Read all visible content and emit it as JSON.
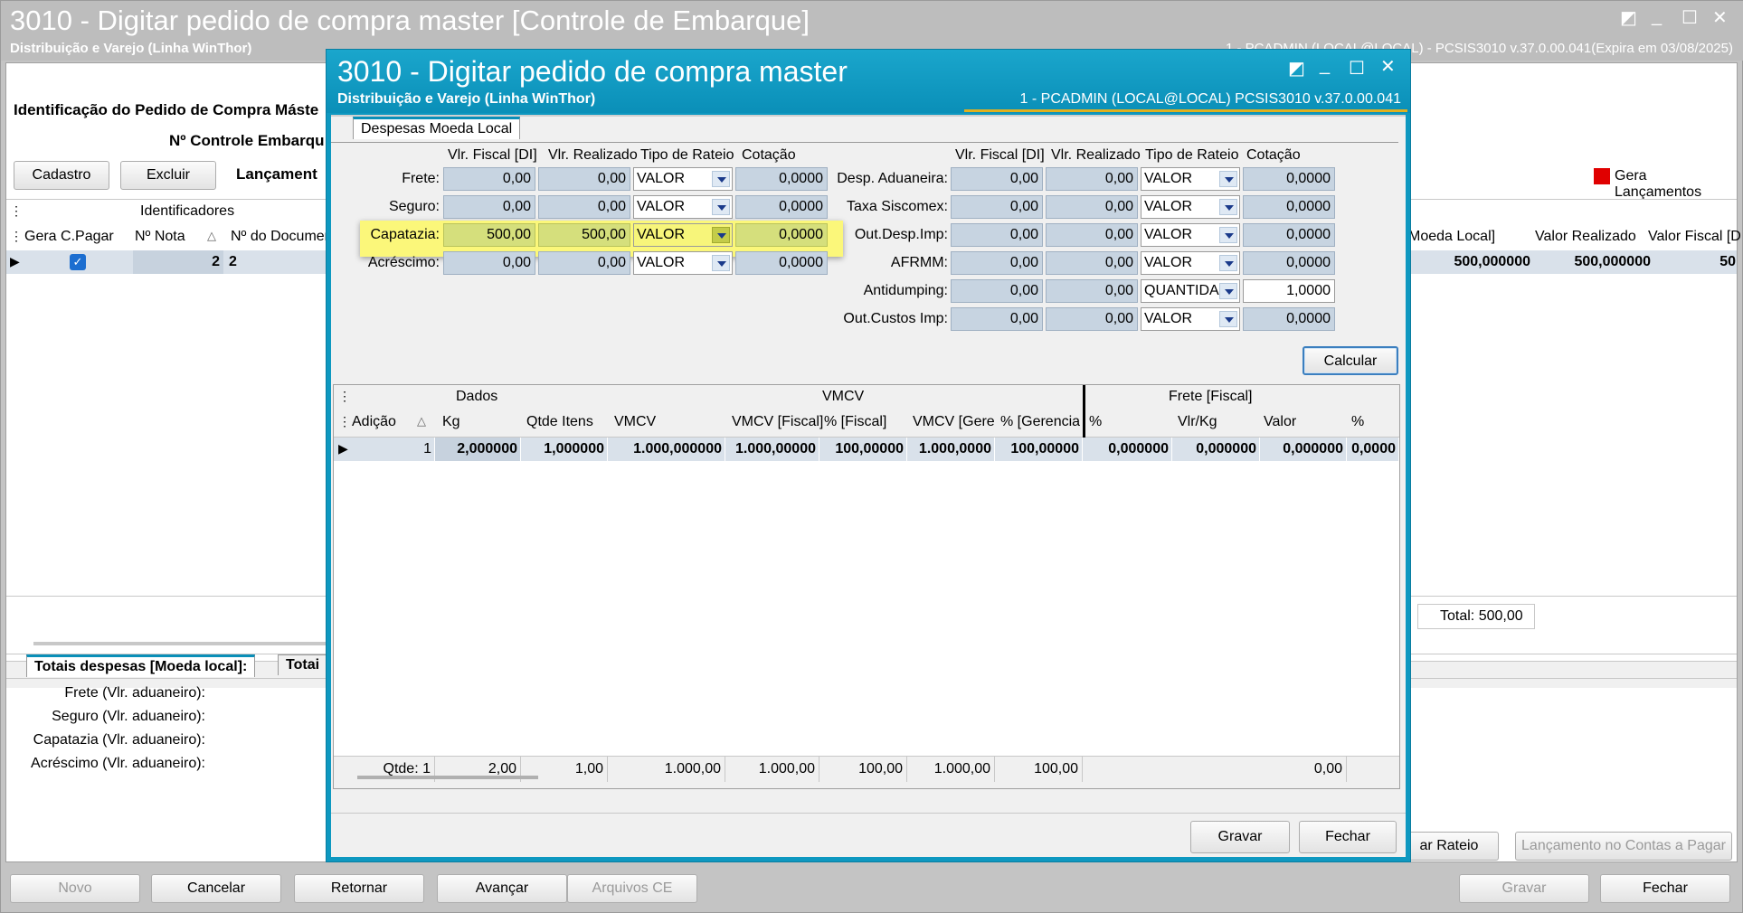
{
  "outer": {
    "title": "3010 - Digitar pedido de compra master [Controle de Embarque]",
    "subtitle": "Distribuição e Varejo (Linha WinThor)",
    "user_info": "1 - PCADMIN (LOCAL@LOCAL) - PCSIS3010  v.37.0.00.041(Expira em 03/08/2025)",
    "ident_label": "Identificação do Pedido de Compra Máste",
    "controle_label": "Nº Controle Embarqu",
    "btn_cadastro": "Cadastro",
    "btn_excluir": "Excluir",
    "lancamentos_label": "Lançament",
    "gera_lancamentos": "Gera Lançamentos",
    "grid": {
      "group_header": "Identificadores",
      "columns": [
        "Gera C.Pagar",
        "Nº Nota",
        "Nº do Documen"
      ],
      "right_columns": [
        "Moeda Local]",
        "Valor Realizado",
        "Valor Fiscal [D"
      ],
      "row": {
        "nota": "2",
        "doc": "2",
        "moeda_local": "500,000000",
        "valor_realizado": "500,000000",
        "valor_fiscal": "50"
      },
      "total": "Total: 500,00"
    },
    "tabs": [
      "Totais despesas [Moeda local]:",
      "Totai"
    ],
    "totals_labels": [
      "Frete (Vlr. aduaneiro):",
      "Seguro (Vlr. aduaneiro):",
      "Capatazia (Vlr. aduaneiro):",
      "Acréscimo (Vlr. aduaneiro):"
    ],
    "btn_rateio": "ar Rateio",
    "btn_lancamento_cp": "Lançamento no Contas a Pagar",
    "bottom_buttons": {
      "novo": "Novo",
      "cancelar": "Cancelar",
      "retornar": "Retornar",
      "avancar": "Avançar",
      "arquivos": "Arquivos CE",
      "gravar": "Gravar",
      "fechar": "Fechar"
    }
  },
  "modal": {
    "title": "3010 - Digitar pedido de compra master",
    "subtitle": "Distribuição e Varejo (Linha WinThor)",
    "user_info": "1 - PCADMIN (LOCAL@LOCAL)   PCSIS3010  v.37.0.00.041",
    "tab": "Despesas Moeda Local",
    "col_headers": {
      "fiscal": "Vlr. Fiscal [DI]",
      "realizado": "Vlr. Realizado",
      "rateio": "Tipo de Rateio",
      "cotacao": "Cotação"
    },
    "left_rows": [
      {
        "label": "Frete:",
        "fiscal": "0,00",
        "realizado": "0,00",
        "rateio": "VALOR",
        "cotacao": "0,0000"
      },
      {
        "label": "Seguro:",
        "fiscal": "0,00",
        "realizado": "0,00",
        "rateio": "VALOR",
        "cotacao": "0,0000"
      },
      {
        "label": "Capatazia:",
        "fiscal": "500,00",
        "realizado": "500,00",
        "rateio": "VALOR",
        "cotacao": "0,0000"
      },
      {
        "label": "Acréscimo:",
        "fiscal": "0,00",
        "realizado": "0,00",
        "rateio": "VALOR",
        "cotacao": "0,0000"
      }
    ],
    "right_rows": [
      {
        "label": "Desp. Aduaneira:",
        "fiscal": "0,00",
        "realizado": "0,00",
        "rateio": "VALOR",
        "cotacao": "0,0000"
      },
      {
        "label": "Taxa Siscomex:",
        "fiscal": "0,00",
        "realizado": "0,00",
        "rateio": "VALOR",
        "cotacao": "0,0000"
      },
      {
        "label": "Out.Desp.Imp:",
        "fiscal": "0,00",
        "realizado": "0,00",
        "rateio": "VALOR",
        "cotacao": "0,0000"
      },
      {
        "label": "AFRMM:",
        "fiscal": "0,00",
        "realizado": "0,00",
        "rateio": "VALOR",
        "cotacao": "0,0000"
      },
      {
        "label": "Antidumping:",
        "fiscal": "0,00",
        "realizado": "0,00",
        "rateio": "QUANTIDA",
        "cotacao": "1,0000"
      },
      {
        "label": "Out.Custos Imp:",
        "fiscal": "0,00",
        "realizado": "0,00",
        "rateio": "VALOR",
        "cotacao": "0,0000"
      }
    ],
    "btn_calcular": "Calcular",
    "grid": {
      "groups": {
        "dados": "Dados",
        "vmcv": "VMCV",
        "frete": "Frete [Fiscal]"
      },
      "columns": [
        "Adição",
        "Kg",
        "Qtde Itens",
        "VMCV",
        "VMCV [Fiscal]",
        "% [Fiscal]",
        "VMCV [Gerer",
        "% [Gerencia",
        "%",
        "Vlr/Kg",
        "Valor",
        "%"
      ],
      "row": [
        "1",
        "2,000000",
        "1,000000",
        "1.000,000000",
        "1.000,00000",
        "100,00000",
        "1.000,0000",
        "100,00000",
        "0,000000",
        "0,000000",
        "0,000000",
        "0,0000"
      ],
      "totals": [
        "Qtde: 1",
        "2,00",
        "1,00",
        "1.000,00",
        "1.000,00",
        "100,00",
        "1.000,00",
        "100,00",
        "",
        "",
        "0,00",
        ""
      ]
    },
    "btn_gravar": "Gravar",
    "btn_fechar": "Fechar"
  }
}
